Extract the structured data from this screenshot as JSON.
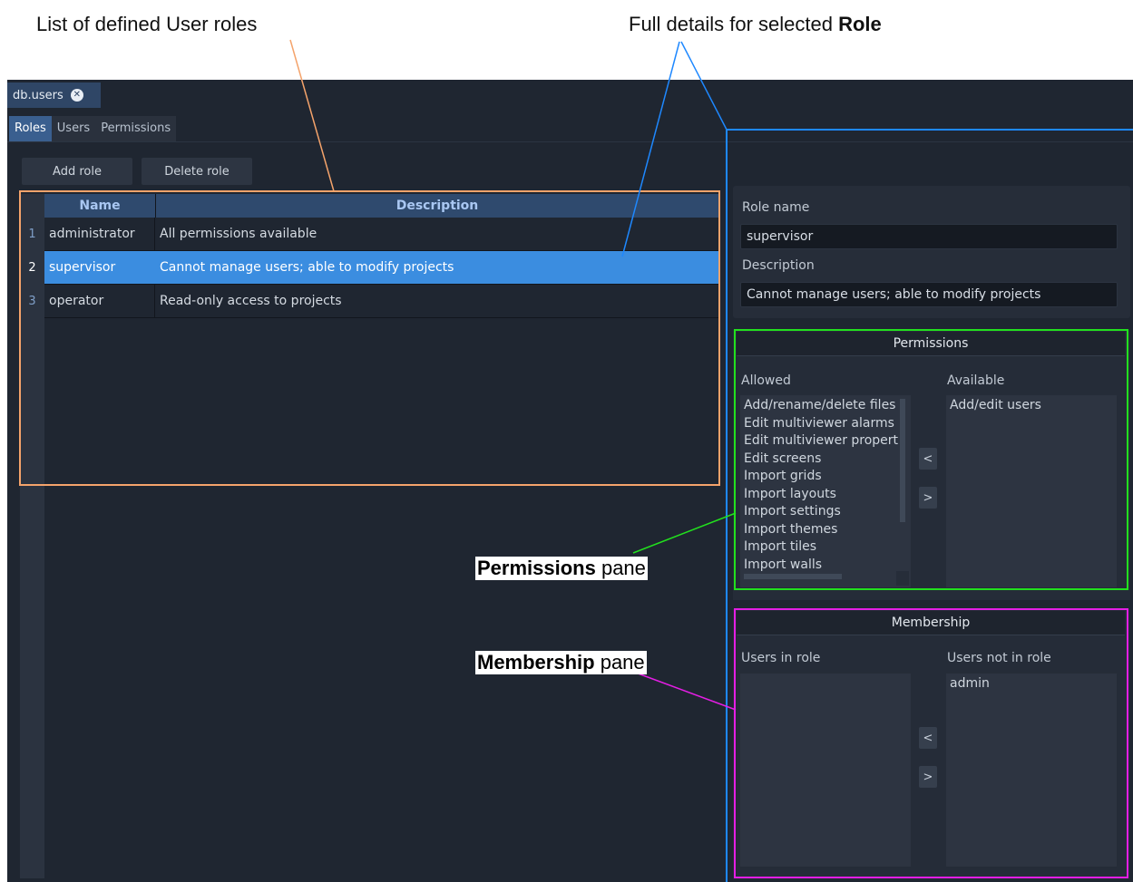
{
  "annotations": {
    "list_callout": "List of defined User roles",
    "details_callout_prefix": "Full details for selected ",
    "details_callout_bold": "Role",
    "permissions_bold": "Permissions",
    "permissions_rest": " pane",
    "membership_bold": "Membership",
    "membership_rest": " pane"
  },
  "document_tab": {
    "label": "db.users",
    "close_glyph": "✕"
  },
  "subtabs": [
    "Roles",
    "Users",
    "Permissions"
  ],
  "toolbar": {
    "add_label": "Add role",
    "delete_label": "Delete role"
  },
  "table": {
    "headers": [
      "Name",
      "Description"
    ],
    "rows": [
      {
        "num": "1",
        "name": "administrator",
        "description": "All permissions available"
      },
      {
        "num": "2",
        "name": "supervisor",
        "description": "Cannot manage users; able to modify projects",
        "selected": true
      },
      {
        "num": "3",
        "name": "operator",
        "description": "Read-only access to projects"
      }
    ]
  },
  "details": {
    "role_name_label": "Role name",
    "role_name_value": "supervisor",
    "description_label": "Description",
    "description_value": "Cannot manage users; able to modify projects"
  },
  "permissions": {
    "title": "Permissions",
    "allowed_label": "Allowed",
    "available_label": "Available",
    "allowed": [
      "Add/rename/delete files",
      "Edit multiviewer alarms",
      "Edit multiviewer propert",
      "Edit screens",
      "Import grids",
      "Import layouts",
      "Import settings",
      "Import themes",
      "Import tiles",
      "Import walls"
    ],
    "available": [
      "Add/edit users"
    ],
    "move_left": "<",
    "move_right": ">"
  },
  "membership": {
    "title": "Membership",
    "in_label": "Users in role",
    "not_in_label": "Users not in role",
    "in": [],
    "not_in": [
      "admin"
    ],
    "move_left": "<",
    "move_right": ">"
  },
  "colors": {
    "list_annotation": "#f4a36b",
    "details_annotation": "#1e88ff",
    "permissions_annotation": "#22e01e",
    "membership_annotation": "#e41ee4",
    "selection": "#3b8de0"
  }
}
